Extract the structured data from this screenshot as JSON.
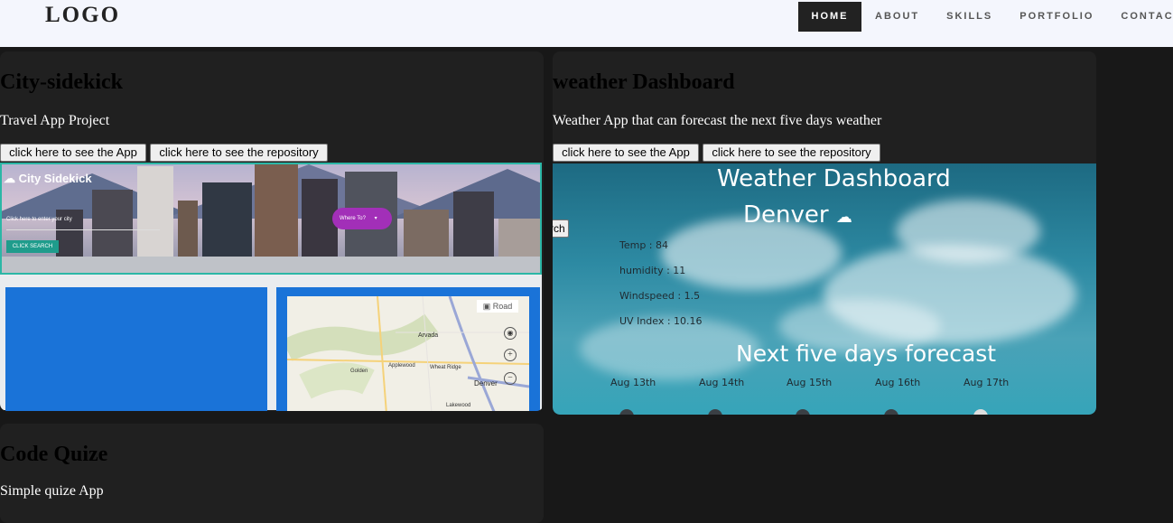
{
  "nav": {
    "logo": "LOGO",
    "items": [
      "HOME",
      "ABOUT",
      "SKILLS",
      "PORTFOLIO",
      "CONTACT"
    ]
  },
  "projects": [
    {
      "title": "City-sidekick",
      "description": "Travel App Project",
      "app_button": "click here to see the App",
      "repo_button": "click here to see the repository",
      "screenshot": {
        "brand": "City Sidekick",
        "input_placeholder": "Click here to enter your city",
        "search_button": "CLICK SEARCH",
        "dropdown": "Where To?",
        "map_layer": "Road",
        "map_places": [
          "Arvada",
          "Wheat Ridge",
          "Golden",
          "Applewood",
          "Denver",
          "Lakewood"
        ]
      }
    },
    {
      "title": "weather Dashboard",
      "description": "Weather App that can forecast the next five days weather",
      "app_button": "click here to see the App",
      "repo_button": "click here to see the repository",
      "screenshot": {
        "heading": "Weather Dashboard",
        "city": "Denver",
        "partial_button": "rch",
        "stats": [
          "Temp : 84",
          "humidity : 11",
          "Windspeed : 1.5",
          "UV Index : 10.16"
        ],
        "forecast_heading": "Next five days forecast",
        "days": [
          "Aug 13th",
          "Aug 14th",
          "Aug 15th",
          "Aug 16th",
          "Aug 17th"
        ]
      }
    },
    {
      "title": "Code Quize",
      "description": "Simple quize App"
    }
  ],
  "colors": {
    "page_bg": "#181818",
    "card_bg": "#202020",
    "navbar_bg": "#f4f6fd",
    "nav_active_bg": "#222222",
    "teal_border": "#2bb7a6",
    "purple_dropdown": "#a22fb8",
    "map_blue": "#1a73d8"
  }
}
